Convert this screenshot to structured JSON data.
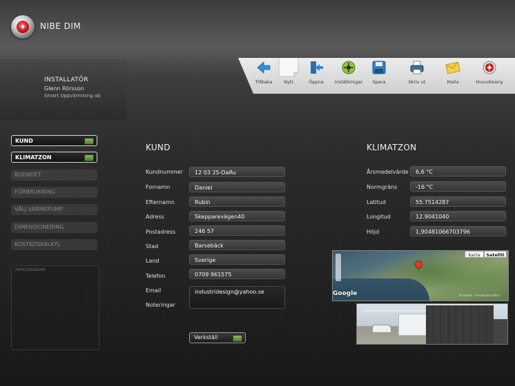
{
  "app": {
    "title": "NIBE DIM"
  },
  "installer": {
    "title": "INSTALLATÖR",
    "name": "Glenn Rörsson",
    "company": "Smart Uppvärmning ab"
  },
  "toolbar": {
    "items": [
      {
        "label": "Tillbaka",
        "icon": "back-arrow-icon"
      },
      {
        "label": "Nytt",
        "icon": "new-document-icon"
      },
      {
        "label": "Öppna",
        "icon": "open-icon"
      },
      {
        "label": "Inställningar",
        "icon": "settings-icon"
      },
      {
        "label": "Spara",
        "icon": "save-icon"
      },
      {
        "label": "Skriv ut",
        "icon": "printer-icon"
      },
      {
        "label": "Maila",
        "icon": "mail-icon"
      },
      {
        "label": "Huvudmeny",
        "icon": "main-menu-icon"
      }
    ]
  },
  "nav": {
    "items": [
      {
        "label": "KUND",
        "active": true
      },
      {
        "label": "KLIMATZON",
        "active": true
      },
      {
        "label": "BOENDET",
        "active": false
      },
      {
        "label": "FÖRBRUKNING",
        "active": false
      },
      {
        "label": "VÄLJ VÄRMEPUMP",
        "active": false
      },
      {
        "label": "DIMENSIONERING",
        "active": false
      },
      {
        "label": "KOSTADSKALKYL",
        "active": false
      }
    ],
    "notes_label": "ANTECKNINGAR"
  },
  "customer": {
    "title": "KUND",
    "fields": [
      {
        "label": "Kundnummer",
        "value": "12 03 25-DaRu"
      },
      {
        "label": "Fornamn",
        "value": "Daniel"
      },
      {
        "label": "Efternamn",
        "value": "Rubin"
      },
      {
        "label": "Adress",
        "value": "Skeppare­vägen40"
      },
      {
        "label": "Postadress",
        "value": "246  57"
      },
      {
        "label": "Stad",
        "value": "Barsebäck"
      },
      {
        "label": "Land",
        "value": "Sverige"
      },
      {
        "label": "Telefon",
        "value": "0709 961575"
      },
      {
        "label": "Email",
        "value": "industridesign@yahoo.se"
      },
      {
        "label": "Noteringar",
        "value": ""
      }
    ],
    "apply_label": "Verkställ"
  },
  "climate": {
    "title": "KLIMATZON",
    "fields": [
      {
        "label": "Årsmedelvärde",
        "value": "6,6 °C"
      },
      {
        "label": "Normgräns",
        "value": "-16 °C"
      },
      {
        "label": "Latitud",
        "value": "55.7514287"
      },
      {
        "label": "Longitud",
        "value": "12.9041040"
      },
      {
        "label": "Höjd",
        "value": "1,90481066703796"
      }
    ]
  },
  "map": {
    "tab_map": "Karta",
    "tab_satellite": "Satellit",
    "logo": "Google",
    "credit": "Kartdata - Användarvillkor"
  },
  "colors": {
    "accent_led": "#6f9a48",
    "logo_red": "#c0141a"
  }
}
